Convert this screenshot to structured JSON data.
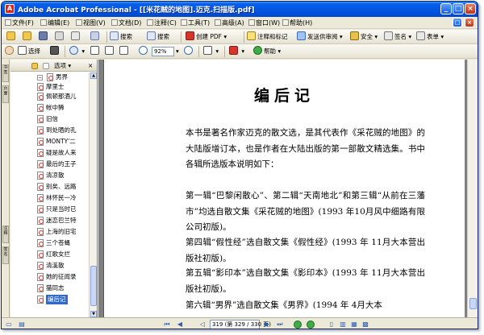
{
  "window": {
    "title": "Adobe Acrobat Professional - [[米花贼的地图].迈克.扫描版.pdf]",
    "app_icon_letter": "A",
    "minimize": "_",
    "maximize": "□",
    "close": "×"
  },
  "menu": {
    "items": [
      {
        "label": "文件(F)"
      },
      {
        "label": "编辑(E)"
      },
      {
        "label": "视图(V)"
      },
      {
        "label": "文档(D)"
      },
      {
        "label": "注释(C)"
      },
      {
        "label": "工具(T)"
      },
      {
        "label": "高级(A)"
      },
      {
        "label": "窗口(W)"
      },
      {
        "label": "帮助(H)"
      }
    ],
    "restore": "□",
    "close": "×"
  },
  "toolbar1": {
    "print_label": "搜索",
    "search_label": "搜索",
    "create_pdf": "创建 PDF",
    "comment_markup": "注释和标记",
    "send_review": "发送供审阅",
    "secure": "安全",
    "sign": "签名",
    "forms": "表单"
  },
  "toolbar2": {
    "select_label": "选择",
    "zoom_value": "92%",
    "help_label": "帮助"
  },
  "panel": {
    "options_label": "选项",
    "bookmarks": [
      {
        "label": "男界"
      },
      {
        "label": "摩里士"
      },
      {
        "label": "佩顿那酒儿"
      },
      {
        "label": "帐中豨"
      },
      {
        "label": "旧信"
      },
      {
        "label": "到处晒的孔"
      },
      {
        "label": "MONTY'二"
      },
      {
        "label": "疑是故人来"
      },
      {
        "label": "最后的王子"
      },
      {
        "label": "清凉散"
      },
      {
        "label": "别矣、远路"
      },
      {
        "label": "林怀民一冷"
      },
      {
        "label": "只是当时已"
      },
      {
        "label": "迷恋巴兰特"
      },
      {
        "label": "上海的旧宅"
      },
      {
        "label": "三个苍蝇"
      },
      {
        "label": "红歌女拦"
      },
      {
        "label": "清溪散"
      },
      {
        "label": "她的征闻录"
      },
      {
        "label": "猫同志"
      },
      {
        "label": "编后记"
      }
    ]
  },
  "navstrip": {
    "tabs": [
      "书签",
      "页面",
      "注释",
      "签名"
    ]
  },
  "document": {
    "title": "编后记",
    "paragraphs": [
      "本书是著名作家迈克的散文选，是其代表作《采花贼的地图》的大陆版增订本，也是作者在大陆出版的第一部散文精选集。书中各辑所选版本说明如下：",
      "第一辑“巴黎闲散心”、第二辑“天南地北”和第三辑“从前在三藩市”均选自散文集《采花贼的地图》(1993 年10月风中细路有限公司初版)。",
      "第四辑“假性经”选自散文集《假性经》(1993 年 11月大本营出版社初版)。",
      "第五辑“影印本”选自散文集《影印本》(1993 年 11月大本营出版社初版)。",
      "第六辑“男界”选自散文集《男界》(1994 年 4月大本"
    ]
  },
  "statusbar": {
    "page_display": "319 (第 329 / 330 页)"
  }
}
